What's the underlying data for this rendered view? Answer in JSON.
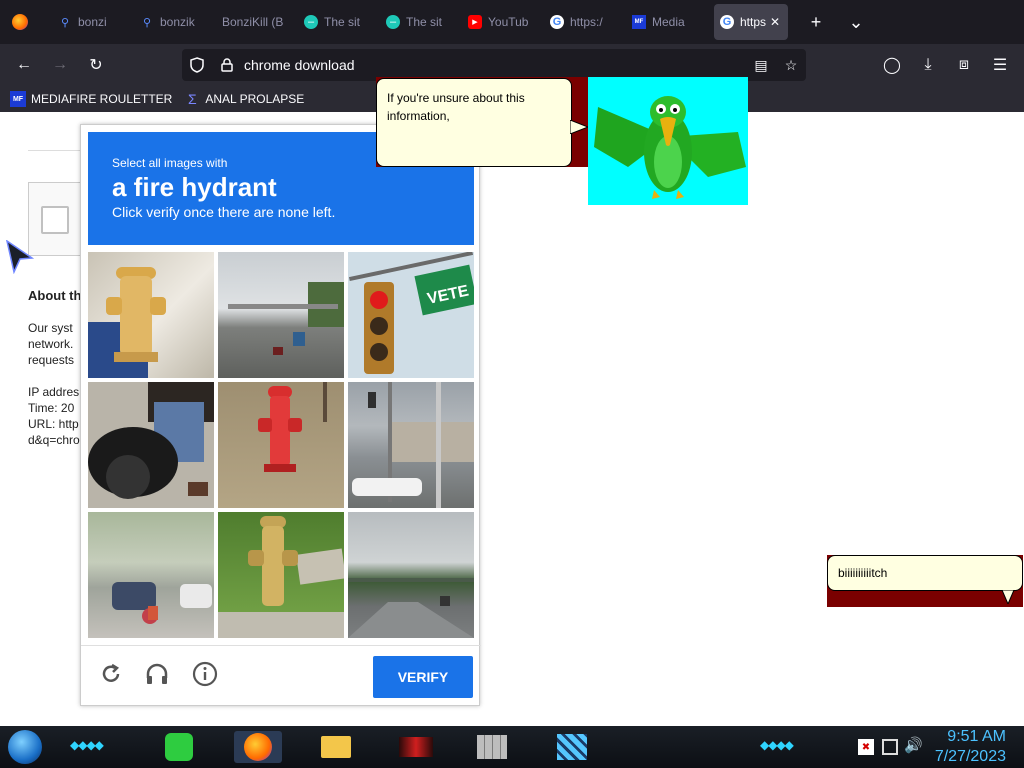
{
  "browser": {
    "tabs": [
      {
        "label": "bonzi",
        "icon": "search-icon",
        "active": false
      },
      {
        "label": "bonzik",
        "icon": "search-icon",
        "active": false
      },
      {
        "label": "BonziKill (B",
        "icon": "",
        "active": false
      },
      {
        "label": "The sit",
        "icon": "site-icon",
        "active": false
      },
      {
        "label": "The sit",
        "icon": "site-icon",
        "active": false
      },
      {
        "label": "YouTub",
        "icon": "youtube-icon",
        "active": false
      },
      {
        "label": "https:/",
        "icon": "google-icon",
        "active": false
      },
      {
        "label": "Media",
        "icon": "mediafire-icon",
        "active": false
      },
      {
        "label": "https",
        "icon": "google-icon",
        "active": true
      }
    ],
    "url": "chrome download",
    "bookmarks": [
      {
        "label": "MEDIAFIRE ROULETTER",
        "icon": "mediafire-icon"
      },
      {
        "label": "ANAL PROLAPSE",
        "icon": "bookmark-icon"
      }
    ],
    "colors": {
      "tabbar": "#1c1b22",
      "navbar": "#2b2a33"
    }
  },
  "page": {
    "about_title": "About th",
    "paragraph": [
      "Our syst",
      "network.",
      "requests"
    ],
    "details": [
      "IP addres",
      "Time: 20",
      "URL: http",
      "d&q=chro"
    ]
  },
  "captcha": {
    "line1": "Select all images with",
    "line2": "a fire hydrant",
    "line3": "Click verify once there are none left.",
    "verify_label": "VERIFY",
    "accent": "#1a73e8",
    "tiles": [
      "fire hydrant",
      "highway traffic",
      "traffic light",
      "motorcycle",
      "fire hydrant",
      "traffic light",
      "street cars",
      "fire hydrant",
      "highway"
    ]
  },
  "bonzi": {
    "bubble1": "If you're unsure about this information,",
    "bubble2": "biiiiiiiiiitch"
  },
  "taskbar": {
    "time": "9:51 AM",
    "date": "7/27/2023"
  }
}
